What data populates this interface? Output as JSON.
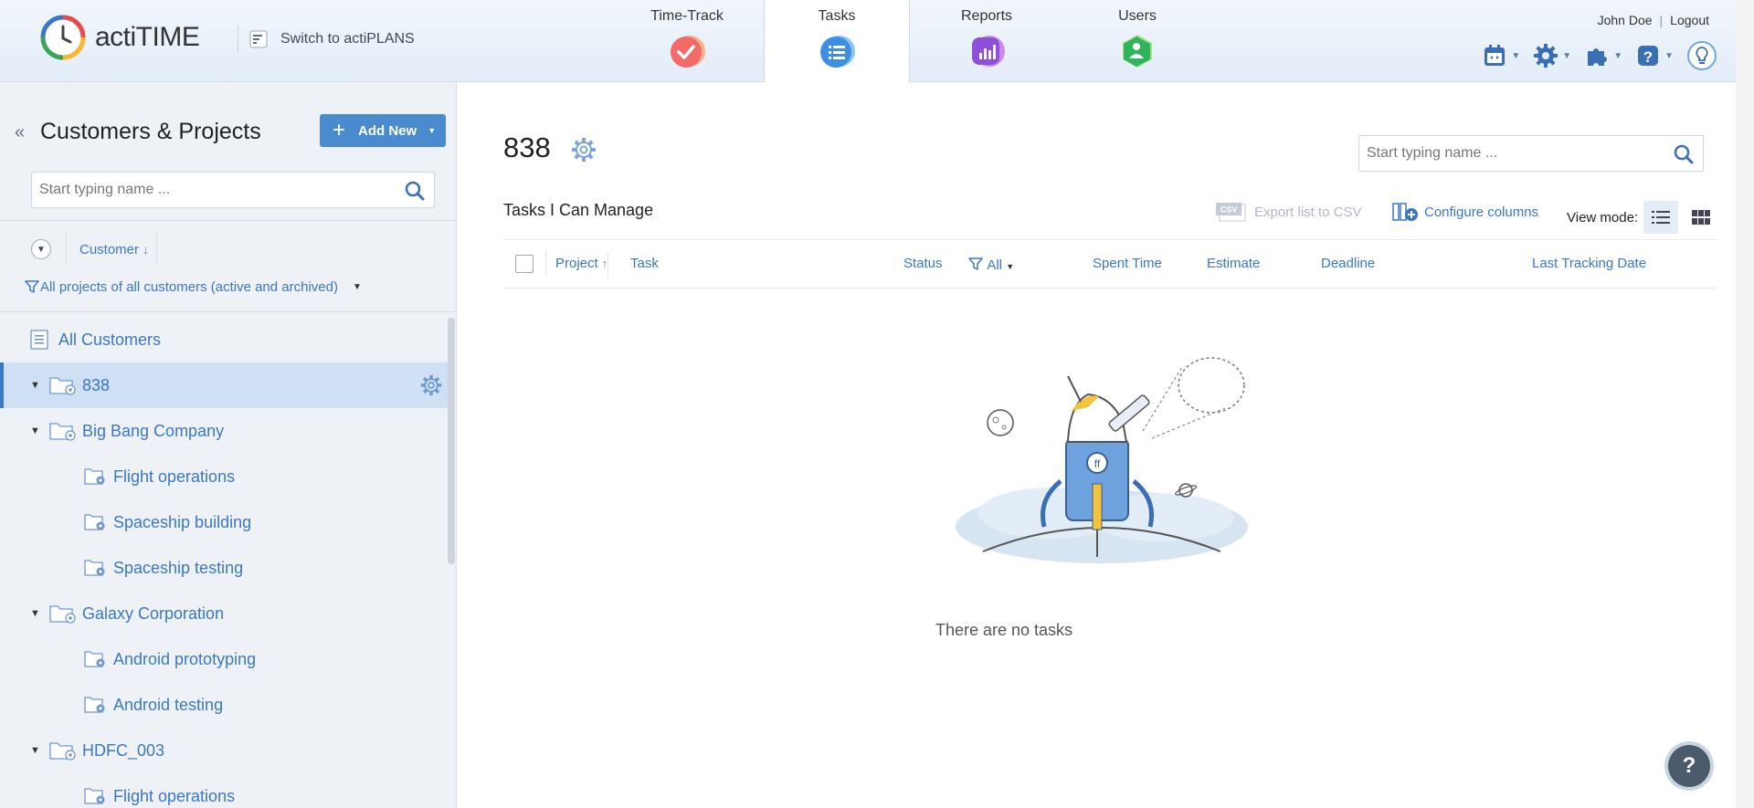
{
  "app": {
    "name": "actiTIME",
    "switch_label": "Switch to actiPLANS"
  },
  "nav": {
    "tabs": [
      {
        "label": "Time-Track",
        "icon": "checkmark-icon",
        "color": "#f26a6a"
      },
      {
        "label": "Tasks",
        "icon": "list-icon",
        "color": "#3d8fe6"
      },
      {
        "label": "Reports",
        "icon": "bar-chart-icon",
        "color": "#8f4fd9"
      },
      {
        "label": "Users",
        "icon": "user-icon",
        "color": "#2fb35c"
      }
    ],
    "active_tab": "Tasks"
  },
  "user": {
    "name": "John Doe",
    "separator": "|",
    "logout": "Logout"
  },
  "sidebar": {
    "title": "Customers & Projects",
    "add_new": "Add New",
    "search_placeholder": "Start typing name ...",
    "sort_label": "Customer",
    "filter_label": "All projects of all customers (active and archived)",
    "all_customers": "All Customers",
    "tree": [
      {
        "type": "customer",
        "label": "838",
        "selected": true
      },
      {
        "type": "customer",
        "label": "Big Bang Company"
      },
      {
        "type": "project",
        "label": "Flight operations"
      },
      {
        "type": "project",
        "label": "Spaceship building"
      },
      {
        "type": "project",
        "label": "Spaceship testing"
      },
      {
        "type": "customer",
        "label": "Galaxy Corporation"
      },
      {
        "type": "project",
        "label": "Android prototyping"
      },
      {
        "type": "project",
        "label": "Android testing"
      },
      {
        "type": "customer",
        "label": "HDFC_003"
      },
      {
        "type": "project",
        "label": "Flight operations"
      }
    ]
  },
  "main": {
    "title": "838",
    "search_placeholder": "Start typing name ...",
    "section_title": "Tasks I Can Manage",
    "export_label": "Export list to CSV",
    "csv_badge": "CSV",
    "configure_label": "Configure columns",
    "view_mode_label": "View mode:",
    "columns": {
      "project": "Project",
      "task": "Task",
      "status": "Status",
      "status_filter": "All",
      "spent_time": "Spent Time",
      "estimate": "Estimate",
      "deadline": "Deadline",
      "last_tracking": "Last Tracking Date"
    },
    "empty_text": "There are no tasks"
  },
  "help": {
    "label": "?"
  },
  "colors": {
    "accent": "#3b78c2",
    "button": "#4a8bd0",
    "selected_row": "#cfe0f4"
  }
}
